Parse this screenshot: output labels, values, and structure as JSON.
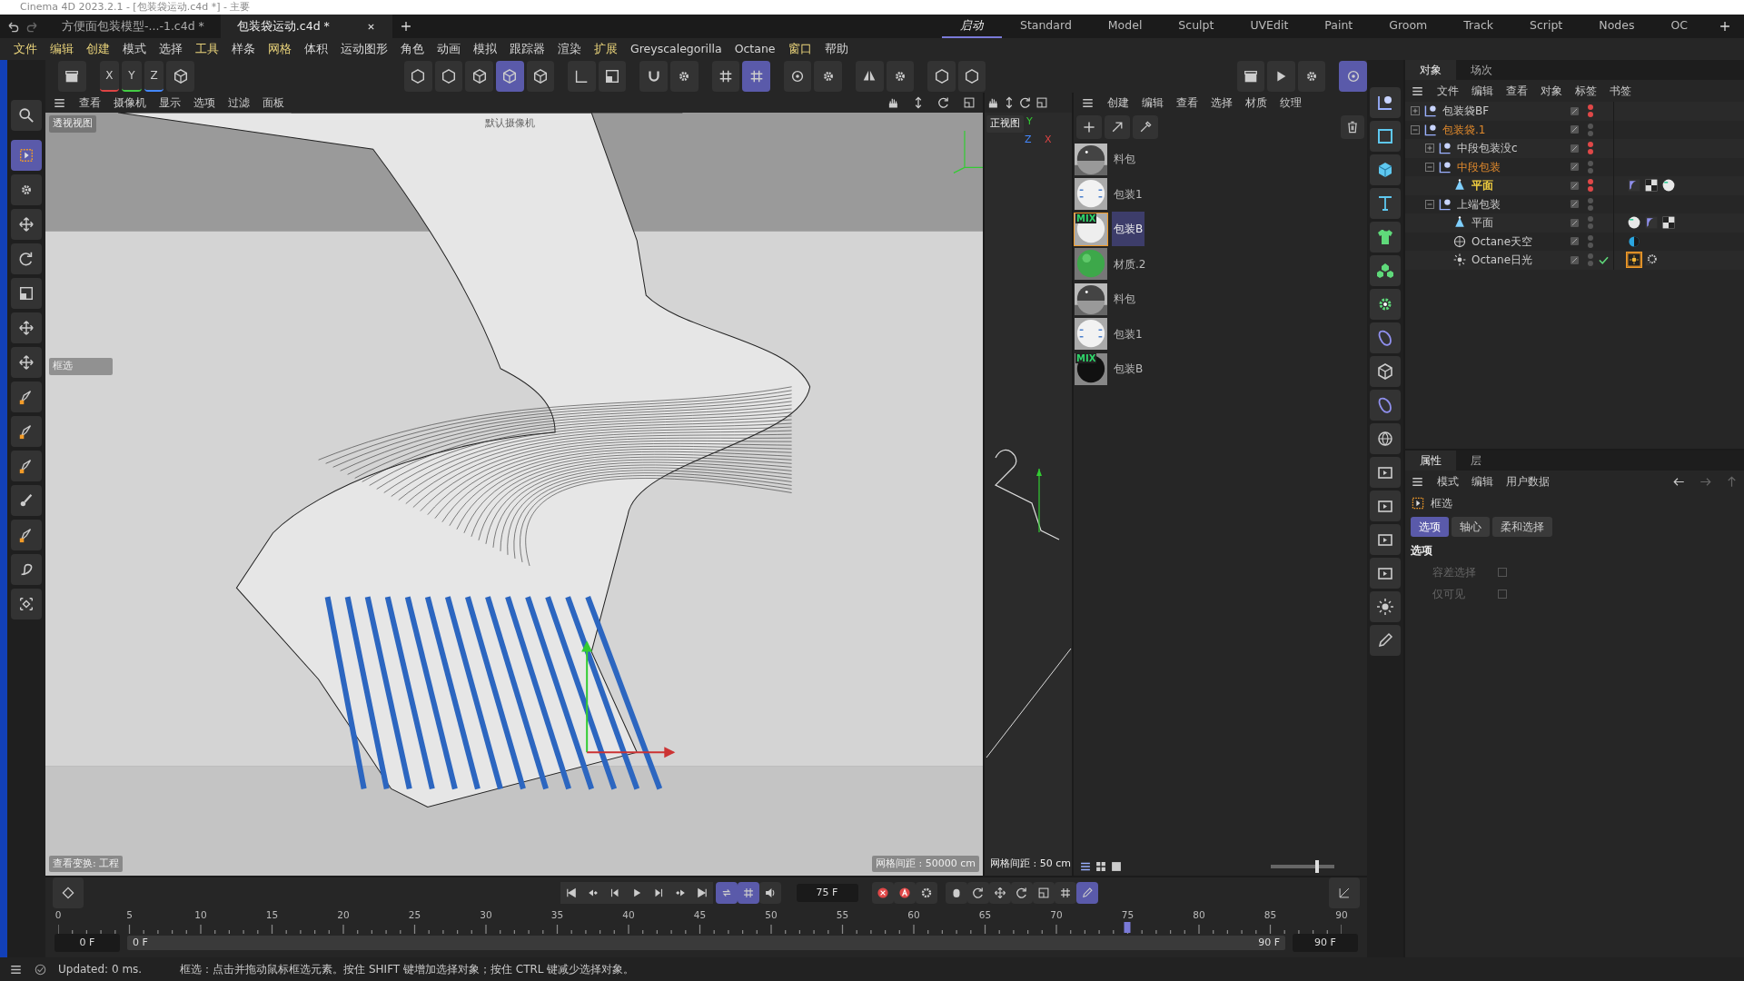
{
  "window": {
    "title": "Cinema 4D 2023.2.1 - [包装袋运动.c4d *] - 主要"
  },
  "doc_tabs": [
    {
      "label": "方便面包装模型-...-1.c4d *",
      "selected": false
    },
    {
      "label": "包装袋运动.c4d *",
      "selected": true
    }
  ],
  "layouts": [
    {
      "label": "启动",
      "selected": true
    },
    {
      "label": "Standard",
      "selected": false
    },
    {
      "label": "Model",
      "selected": false
    },
    {
      "label": "Sculpt",
      "selected": false
    },
    {
      "label": "UVEdit",
      "selected": false
    },
    {
      "label": "Paint",
      "selected": false
    },
    {
      "label": "Groom",
      "selected": false
    },
    {
      "label": "Track",
      "selected": false
    },
    {
      "label": "Script",
      "selected": false
    },
    {
      "label": "Nodes",
      "selected": false
    },
    {
      "label": "OC",
      "selected": false
    }
  ],
  "menu": [
    {
      "label": "文件",
      "accent": true
    },
    {
      "label": "编辑",
      "accent": true
    },
    {
      "label": "创建",
      "accent": true
    },
    {
      "label": "模式",
      "accent": false
    },
    {
      "label": "选择",
      "accent": false
    },
    {
      "label": "工具",
      "accent": true
    },
    {
      "label": "样条",
      "accent": false
    },
    {
      "label": "网格",
      "accent": true
    },
    {
      "label": "体积",
      "accent": false
    },
    {
      "label": "运动图形",
      "accent": false
    },
    {
      "label": "角色",
      "accent": false
    },
    {
      "label": "动画",
      "accent": false
    },
    {
      "label": "模拟",
      "accent": false
    },
    {
      "label": "跟踪器",
      "accent": false
    },
    {
      "label": "渲染",
      "accent": false
    },
    {
      "label": "扩展",
      "accent": true
    },
    {
      "label": "Greyscalegorilla",
      "accent": false
    },
    {
      "label": "Octane",
      "accent": false
    },
    {
      "label": "窗口",
      "accent": true
    },
    {
      "label": "帮助",
      "accent": false
    }
  ],
  "toolbar": {
    "axes": [
      "X",
      "Y",
      "Z"
    ]
  },
  "viewport": {
    "menu": [
      "查看",
      "摄像机",
      "显示",
      "选项",
      "过滤",
      "面板"
    ],
    "view_label": "透视视图",
    "camera_label": "默认摄像机",
    "tool_label": "框选",
    "transform_label": "查看变换: 工程",
    "grid_spacing": "网格间距 : 50000 cm"
  },
  "front_view": {
    "view_label": "正视图",
    "axes": [
      "Y",
      "Z",
      "X"
    ],
    "grid_spacing": "网格间距 : 50 cm"
  },
  "material_manager": {
    "menu": [
      "创建",
      "编辑",
      "查看",
      "选择",
      "材质",
      "纹理"
    ],
    "materials": [
      {
        "name": "料包",
        "kind": "checker",
        "selected": false
      },
      {
        "name": "包装1",
        "kind": "white",
        "selected": false
      },
      {
        "name": "包装B",
        "kind": "mix",
        "badge": "MIX",
        "selected": true
      },
      {
        "name": "材质.2",
        "kind": "green",
        "selected": false
      },
      {
        "name": "料包",
        "kind": "checker",
        "selected": false
      },
      {
        "name": "包装1",
        "kind": "white",
        "selected": false
      },
      {
        "name": "包装B",
        "kind": "mixdark",
        "badge": "MIX",
        "selected": false
      }
    ],
    "zoom": {
      "level": 0.75
    }
  },
  "object_manager": {
    "tabs": [
      {
        "label": "对象",
        "selected": true
      },
      {
        "label": "场次",
        "selected": false
      }
    ],
    "menu": [
      "文件",
      "编辑",
      "查看",
      "对象",
      "标签",
      "书签"
    ],
    "objects": [
      {
        "name": "包装袋BF",
        "kind": "null",
        "expanded": false,
        "highlighted": false,
        "selected": false,
        "hidden_editor": true,
        "hidden_render": true
      },
      {
        "name": "包装袋.1",
        "kind": "null",
        "expanded": true,
        "highlighted": true,
        "selected": false,
        "hidden_editor": false,
        "hidden_render": false,
        "children": [
          {
            "name": "中段包装没c",
            "kind": "null",
            "expanded": false,
            "highlighted": false,
            "selected": false,
            "hidden_editor": true,
            "hidden_render": true
          },
          {
            "name": "中段包装",
            "kind": "null",
            "expanded": true,
            "highlighted": true,
            "selected": false,
            "hidden_editor": false,
            "hidden_render": false,
            "children": [
              {
                "name": "平面",
                "kind": "plane",
                "highlighted": false,
                "selected": true,
                "hidden_editor": true,
                "hidden_render": true,
                "tags": [
                  {
                    "kind": "phong",
                    "selected": false
                  },
                  {
                    "kind": "uv",
                    "selected": false
                  },
                  {
                    "kind": "material",
                    "selected": false
                  }
                ]
              }
            ]
          },
          {
            "name": "上端包装",
            "kind": "null",
            "expanded": true,
            "highlighted": false,
            "selected": false,
            "hidden_editor": false,
            "hidden_render": false,
            "children": [
              {
                "name": "平面",
                "kind": "plane",
                "highlighted": false,
                "selected": false,
                "hidden_editor": false,
                "hidden_render": false,
                "tags": [
                  {
                    "kind": "material",
                    "selected": false
                  },
                  {
                    "kind": "phong",
                    "selected": false
                  },
                  {
                    "kind": "uv",
                    "selected": false
                  }
                ]
              },
              {
                "name": "Octane天空",
                "kind": "sky",
                "highlighted": false,
                "selected": false,
                "hidden_editor": false,
                "hidden_render": false,
                "tags": [
                  {
                    "kind": "environment",
                    "selected": false
                  }
                ]
              },
              {
                "name": "Octane日光",
                "kind": "sun",
                "highlighted": false,
                "selected": false,
                "hidden_editor": false,
                "hidden_render": false,
                "enabled": true,
                "tags": [
                  {
                    "kind": "sun",
                    "selected": true
                  },
                  {
                    "kind": "octane",
                    "selected": false
                  }
                ]
              }
            ]
          }
        ]
      }
    ]
  },
  "attributes": {
    "tabs": [
      {
        "label": "属性",
        "selected": true
      },
      {
        "label": "层",
        "selected": false
      }
    ],
    "menu": [
      "模式",
      "编辑",
      "用户数据"
    ],
    "tool": "框选",
    "subtabs": [
      {
        "label": "选项",
        "selected": true
      },
      {
        "label": "轴心",
        "selected": false
      },
      {
        "label": "柔和选择",
        "selected": false
      }
    ],
    "section": "选项",
    "options": [
      {
        "label": "容差选择",
        "checked": false,
        "disabled": true
      },
      {
        "label": "仅可见",
        "checked": false,
        "disabled": true
      }
    ]
  },
  "timeline": {
    "frame": "75 F",
    "ticks": [
      "0",
      "5",
      "10",
      "15",
      "20",
      "25",
      "30",
      "35",
      "40",
      "45",
      "50",
      "55",
      "60",
      "65",
      "70",
      "75",
      "80",
      "85",
      "90"
    ],
    "playhead": {
      "level": 0.8333
    },
    "start": "0 F",
    "range_start": "0 F",
    "range_end": "90 F",
    "end": "90 F"
  },
  "status_bar": {
    "message": "Updated: 0 ms.",
    "hint": "框选：点击并拖动鼠标框选元素。按住 SHIFT 键增加选择对象；按住 CTRL 键减少选择对象。"
  }
}
